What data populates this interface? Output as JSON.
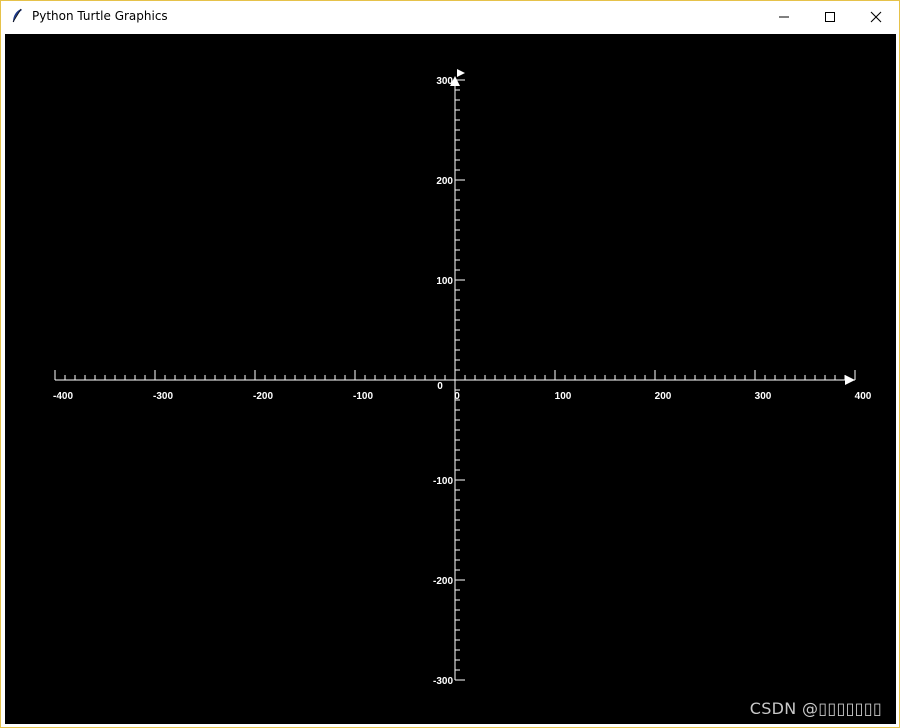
{
  "window": {
    "title": "Python Turtle Graphics",
    "icon": "feather-icon",
    "controls": {
      "minimize": "minimize-icon",
      "maximize": "maximize-icon",
      "close": "close-icon"
    }
  },
  "canvas": {
    "background": "#000000",
    "ink": "#ffffff"
  },
  "chart_data": {
    "type": "axes",
    "x_axis": {
      "range": [
        -400,
        400
      ],
      "major_step": 100,
      "minor_step": 10,
      "tick_labels": [
        "-400",
        "-300",
        "-200",
        "-100",
        "0",
        "100",
        "200",
        "300",
        "400"
      ]
    },
    "y_axis": {
      "range": [
        -300,
        300
      ],
      "major_step": 100,
      "minor_step": 10,
      "tick_labels": [
        "300",
        "200",
        "100",
        "-100",
        "-200",
        "-300"
      ]
    },
    "origin_labels": [
      "0",
      "0"
    ],
    "arrowheads": [
      "x-positive",
      "y-positive"
    ]
  },
  "watermark": "CSDN @▯▯▯▯▯▯▯"
}
